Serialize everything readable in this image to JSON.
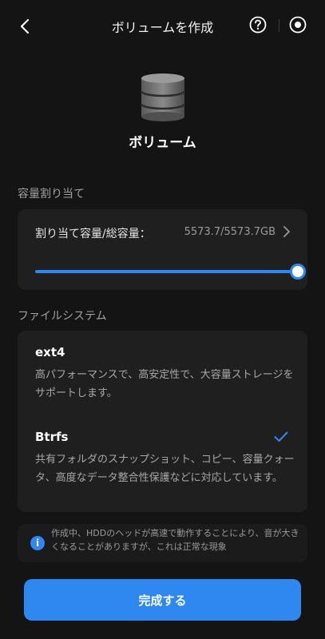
{
  "header": {
    "title": "ボリュームを作成"
  },
  "volume": {
    "label": "ボリューム"
  },
  "allocation": {
    "section_title": "容量割り当て",
    "label": "割り当て容量/総容量：",
    "value": "5573.7/5573.7GB",
    "slider_fraction": 1.0
  },
  "filesystem": {
    "section_title": "ファイルシステム",
    "options": [
      {
        "name": "ext4",
        "description": "高パフォーマンスで、高安定性で、大容量ストレージをサポートします。",
        "selected": false
      },
      {
        "name": "Btrfs",
        "description": "共有フォルダのスナップショット、コピー、容量クォータ、高度なデータ整合性保護などに対応しています。",
        "selected": true
      }
    ]
  },
  "notice": {
    "text": "作成中、HDDのヘッドが高速で動作することにより、音が大きくなることがありますが、これは正常な現象"
  },
  "footer": {
    "finish_label": "完成する"
  },
  "colors": {
    "accent": "#2e88f0",
    "background": "#141414",
    "card": "#1f1f1f"
  },
  "icons": [
    "back-arrow-icon",
    "help-icon",
    "target-icon",
    "volume-stack-icon",
    "chevron-right-icon",
    "checkmark-icon",
    "info-icon"
  ]
}
